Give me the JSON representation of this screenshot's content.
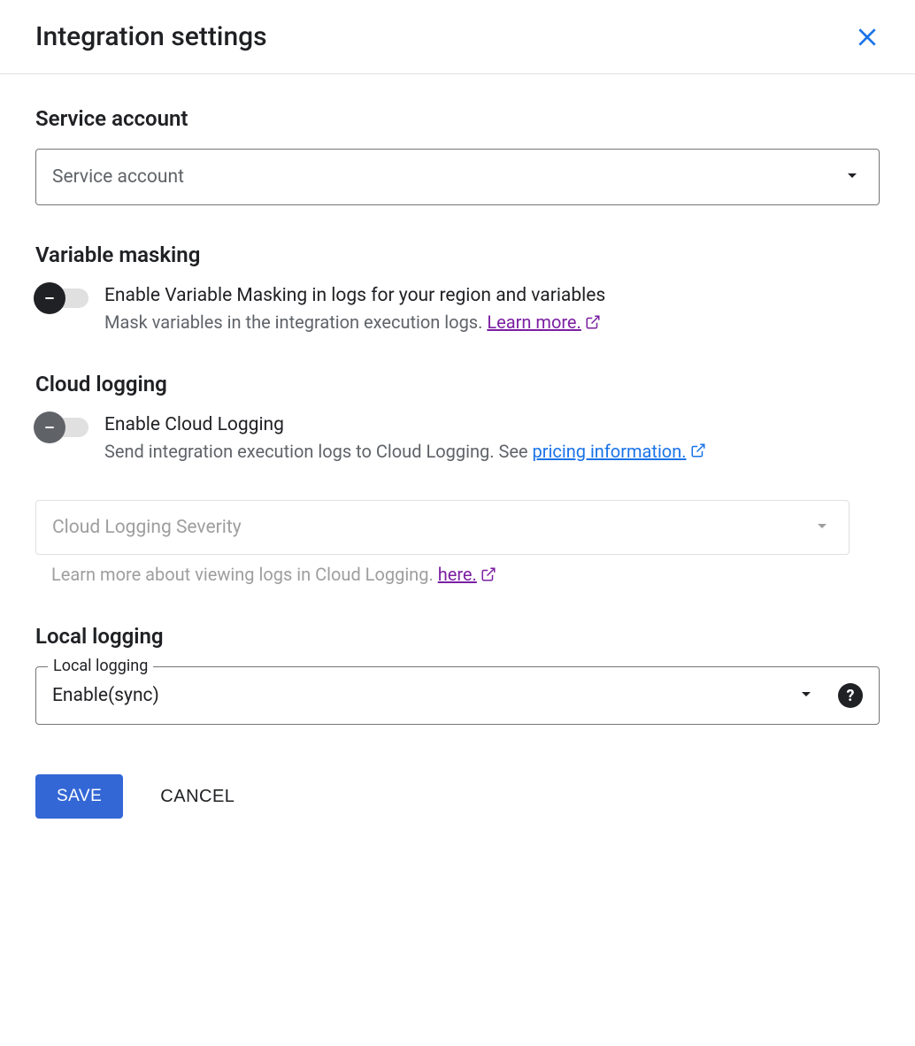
{
  "header": {
    "title": "Integration settings"
  },
  "serviceAccount": {
    "title": "Service account",
    "placeholder": "Service account"
  },
  "variableMasking": {
    "title": "Variable masking",
    "toggleLabel": "Enable Variable Masking in logs for your region and variables",
    "description": "Mask variables in the integration execution logs. ",
    "learnMore": "Learn more."
  },
  "cloudLogging": {
    "title": "Cloud logging",
    "toggleLabel": "Enable Cloud Logging",
    "description": "Send integration execution logs to Cloud Logging. See ",
    "pricingLink": "pricing information.",
    "severityPlaceholder": "Cloud Logging Severity",
    "helperText": "Learn more about viewing logs in Cloud Logging. ",
    "hereLink": "here."
  },
  "localLogging": {
    "title": "Local logging",
    "fieldLabel": "Local logging",
    "value": "Enable(sync)"
  },
  "footer": {
    "save": "SAVE",
    "cancel": "CANCEL"
  }
}
